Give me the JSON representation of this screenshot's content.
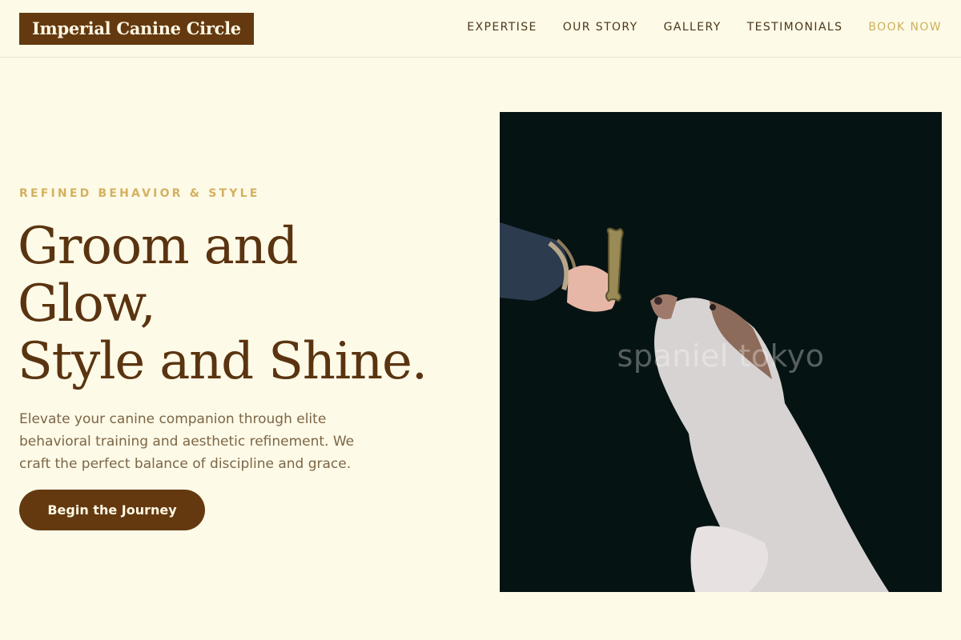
{
  "brand": {
    "name": "Imperial Canine Circle"
  },
  "nav": {
    "items": [
      "EXPERTISE",
      "OUR STORY",
      "GALLERY",
      "TESTIMONIALS"
    ],
    "book_label": "BOOK NOW"
  },
  "hero": {
    "eyebrow": "REFINED BEHAVIOR & STYLE",
    "headline_lines": [
      "Groom and",
      "Glow,",
      "Style and Shine."
    ],
    "description": "Elevate your canine companion through elite behavioral training and aesthetic refinement. We craft the perfect balance of discipline and grace.",
    "cta_label": "Begin the Journey"
  },
  "image": {
    "watermark": "spaniel tokyo"
  },
  "colors": {
    "background": "#fefae8",
    "brand_brown": "#64390f",
    "accent_gold": "#d3b15f",
    "photo_background": "#061313"
  }
}
